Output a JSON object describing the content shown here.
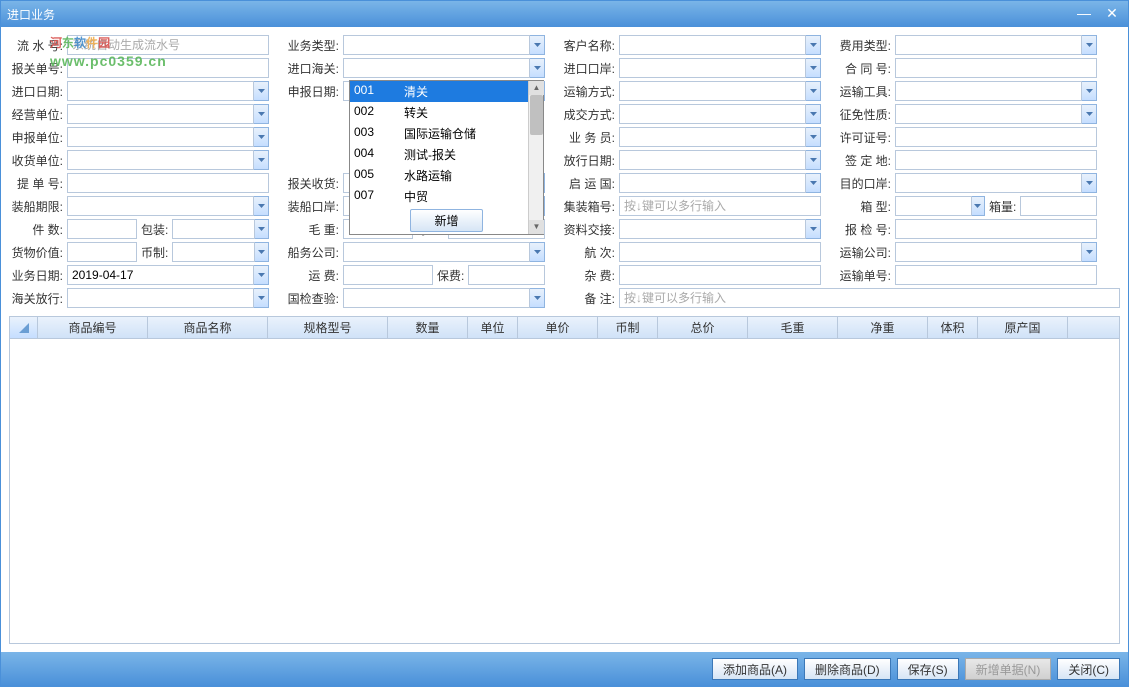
{
  "window": {
    "title": "进口业务"
  },
  "watermark": {
    "line1": "河东软件园",
    "line2": "www.pc0359.cn"
  },
  "labels": {
    "serial_no": "流 水 号:",
    "business_type": "业务类型:",
    "customer_name": "客户名称:",
    "fee_type": "费用类型:",
    "customs_no": "报关单号:",
    "import_customs": "进口海关:",
    "import_port": "进口口岸:",
    "contract_no": "合 同 号:",
    "import_date": "进口日期:",
    "declare_date": "申报日期:",
    "transport_mode": "运输方式:",
    "transport_tool": "运输工具:",
    "business_unit": "经营单位:",
    "deal_mode": "成交方式:",
    "exempt_nature": "征免性质:",
    "declare_unit": "申报单位:",
    "salesman": "业 务 员:",
    "permit_no": "许可证号:",
    "receive_unit": "收货单位:",
    "release_date": "放行日期:",
    "sign_place": "签 定 地:",
    "bill_no": "提 单 号:",
    "customs_receive": "报关收货:",
    "depart_country": "启 运 国:",
    "dest_port": "目的口岸:",
    "ship_deadline": "装船期限:",
    "ship_port": "装船口岸:",
    "container_no": "集装箱号:",
    "box_type": "箱    型:",
    "box_qty": "箱量:",
    "piece_qty": "件    数:",
    "package": "包装:",
    "gross_weight": "毛    重:",
    "net_weight": "净重:",
    "data_handover": "资料交接:",
    "inspect_no": "报 检 号:",
    "goods_value": "货物价值:",
    "currency": "币制:",
    "shipping_co": "船务公司:",
    "voyage": "航    次:",
    "transport_co": "运输公司:",
    "business_date": "业务日期:",
    "freight": "运    费:",
    "insurance": "保费:",
    "misc_fee": "杂    费:",
    "transport_no": "运输单号:",
    "customs_release": "海关放行:",
    "ciq_check": "国检查验:",
    "remark": "备    注:"
  },
  "values": {
    "serial_no_placeholder": "系统自动生成流水号",
    "business_date": "2019-04-17",
    "container_placeholder": "按↓键可以多行输入",
    "remark_placeholder": "按↓键可以多行输入"
  },
  "dropdown": {
    "items": [
      {
        "code": "001",
        "text": "清关"
      },
      {
        "code": "002",
        "text": "转关"
      },
      {
        "code": "003",
        "text": "国际运输仓储"
      },
      {
        "code": "004",
        "text": "测试-报关"
      },
      {
        "code": "005",
        "text": "水路运输"
      },
      {
        "code": "007",
        "text": "中贸"
      }
    ],
    "new_label": "新增"
  },
  "grid_headers": [
    "商品编号",
    "商品名称",
    "规格型号",
    "数量",
    "单位",
    "单价",
    "币制",
    "总价",
    "毛重",
    "净重",
    "体积",
    "原产国"
  ],
  "grid_widths": [
    110,
    120,
    120,
    80,
    50,
    80,
    60,
    90,
    90,
    90,
    50,
    90
  ],
  "footer": {
    "add_product": "添加商品(A)",
    "delete_product": "删除商品(D)",
    "save": "保存(S)",
    "new_bill": "新增单据(N)",
    "close": "关闭(C)"
  }
}
